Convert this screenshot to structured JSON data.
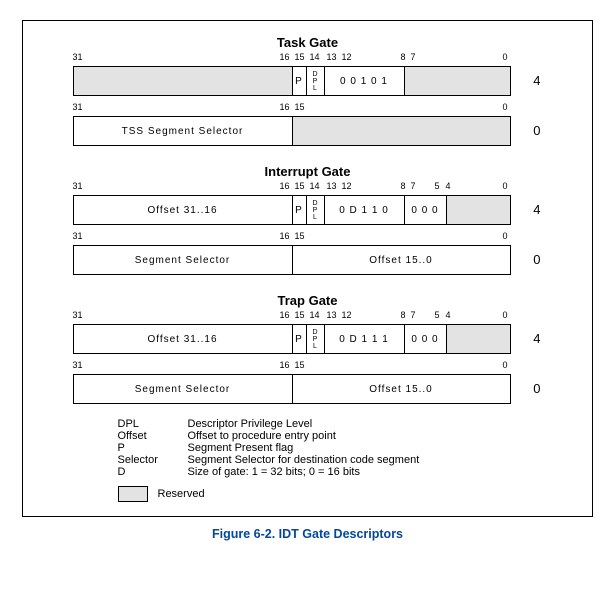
{
  "figure": {
    "caption": "Figure 6-2.  IDT Gate Descriptors"
  },
  "gates": {
    "task": {
      "title": "Task Gate",
      "row1": {
        "bits": {
          "b31": "31",
          "b16": "16",
          "b15": "15",
          "b14": "14",
          "b13": "13",
          "b12": "12",
          "b8": "8",
          "b7": "7",
          "b0": "0"
        },
        "p": "P",
        "dpl": "D\nP\nL",
        "type": "0 0 1 0 1",
        "sidenum": "4"
      },
      "row2": {
        "bits": {
          "b31": "31",
          "b16": "16",
          "b15": "15",
          "b0": "0"
        },
        "left": "TSS Segment Selector",
        "sidenum": "0"
      }
    },
    "interrupt": {
      "title": "Interrupt Gate",
      "row1": {
        "bits": {
          "b31": "31",
          "b16": "16",
          "b15": "15",
          "b14": "14",
          "b13": "13",
          "b12": "12",
          "b8": "8",
          "b7": "7",
          "b5": "5",
          "b4": "4",
          "b0": "0"
        },
        "left": "Offset 31..16",
        "p": "P",
        "dpl": "D\nP\nL",
        "type": "0 D 1 1 0",
        "zeros": "0 0 0",
        "sidenum": "4"
      },
      "row2": {
        "bits": {
          "b31": "31",
          "b16": "16",
          "b15": "15",
          "b0": "0"
        },
        "left": "Segment Selector",
        "right": "Offset 15..0",
        "sidenum": "0"
      }
    },
    "trap": {
      "title": "Trap Gate",
      "row1": {
        "bits": {
          "b31": "31",
          "b16": "16",
          "b15": "15",
          "b14": "14",
          "b13": "13",
          "b12": "12",
          "b8": "8",
          "b7": "7",
          "b5": "5",
          "b4": "4",
          "b0": "0"
        },
        "left": "Offset 31..16",
        "p": "P",
        "dpl": "D\nP\nL",
        "type": "0 D 1 1 1",
        "zeros": "0 0 0",
        "sidenum": "4"
      },
      "row2": {
        "bits": {
          "b31": "31",
          "b16": "16",
          "b15": "15",
          "b0": "0"
        },
        "left": "Segment Selector",
        "right": "Offset 15..0",
        "sidenum": "0"
      }
    }
  },
  "legend": {
    "dpl": {
      "key": "DPL",
      "desc": "Descriptor Privilege Level"
    },
    "offset": {
      "key": "Offset",
      "desc": "Offset to procedure entry point"
    },
    "p": {
      "key": "P",
      "desc": "Segment Present flag"
    },
    "selector": {
      "key": "Selector",
      "desc": "Segment Selector for destination code segment"
    },
    "d": {
      "key": "D",
      "desc": "Size of gate: 1 = 32 bits; 0 = 16 bits"
    },
    "reserved": "Reserved"
  }
}
